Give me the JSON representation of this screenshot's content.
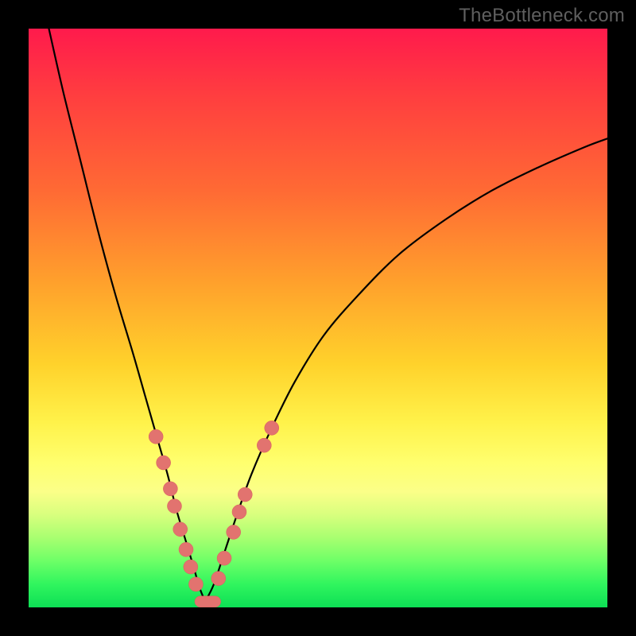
{
  "watermark": "TheBottleneck.com",
  "colors": {
    "frame": "#000000",
    "gradient_top": "#ff1a4c",
    "gradient_bottom": "#0ddf55",
    "curve": "#000000",
    "marker": "#e2736f"
  },
  "chart_data": {
    "type": "line",
    "title": "",
    "xlabel": "",
    "ylabel": "",
    "xlim": [
      0,
      100
    ],
    "ylim": [
      0,
      100
    ],
    "note": "No numeric axes or tick labels are present in the image; values are normalized 0–100 estimates of pixel positions.",
    "series": [
      {
        "name": "left-branch",
        "x": [
          3.5,
          6,
          9,
          12,
          15,
          18,
          20,
          22,
          24,
          25.5,
          27,
          28.5,
          29.5,
          30.5
        ],
        "y": [
          100,
          89,
          77,
          65,
          54,
          44,
          37,
          30,
          23,
          17,
          12,
          7,
          3.5,
          1
        ]
      },
      {
        "name": "right-branch",
        "x": [
          30.5,
          32,
          34,
          36,
          38.5,
          42,
          46,
          51,
          57,
          64,
          72,
          80,
          88,
          96,
          100
        ],
        "y": [
          1,
          4,
          10,
          16,
          23,
          31,
          39,
          47,
          54,
          61,
          67,
          72,
          76,
          79.5,
          81
        ]
      }
    ],
    "markers": {
      "name": "highlight-dots",
      "note": "Salmon-colored dots along the curve near the trough; coordinates are normalized to 0–100.",
      "points": [
        {
          "x": 22.0,
          "y": 29.5
        },
        {
          "x": 23.3,
          "y": 25.0
        },
        {
          "x": 24.5,
          "y": 20.5
        },
        {
          "x": 25.2,
          "y": 17.5
        },
        {
          "x": 26.2,
          "y": 13.5
        },
        {
          "x": 27.2,
          "y": 10.0
        },
        {
          "x": 28.0,
          "y": 7.0
        },
        {
          "x": 28.9,
          "y": 4.0
        },
        {
          "x": 32.8,
          "y": 5.0
        },
        {
          "x": 33.8,
          "y": 8.5
        },
        {
          "x": 35.4,
          "y": 13.0
        },
        {
          "x": 36.4,
          "y": 16.5
        },
        {
          "x": 37.4,
          "y": 19.5
        },
        {
          "x": 40.7,
          "y": 28.0
        },
        {
          "x": 42.0,
          "y": 31.0
        }
      ],
      "radius": 9
    },
    "flat_bar": {
      "name": "trough-bar",
      "x0": 28.7,
      "x1": 33.2,
      "y": 1.0,
      "thickness": 14
    }
  }
}
